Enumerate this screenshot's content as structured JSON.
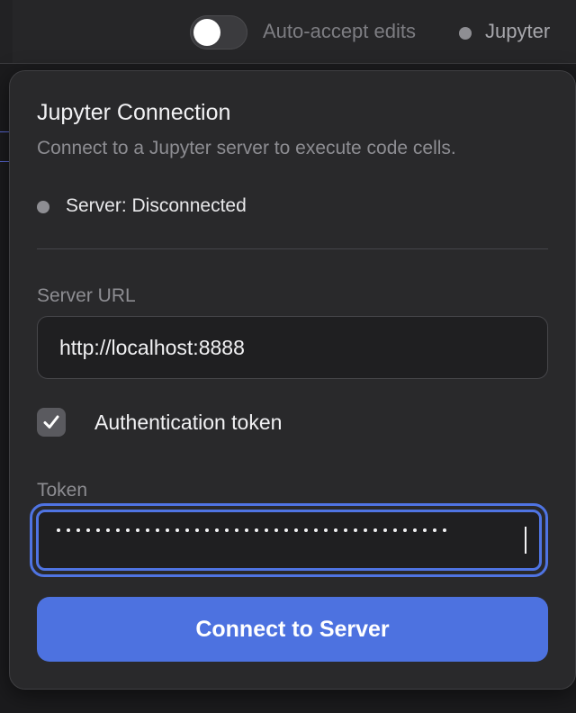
{
  "topbar": {
    "auto_accept_label": "Auto-accept edits",
    "auto_accept_on": false,
    "kernel_label": "Jupyter"
  },
  "panel": {
    "title": "Jupyter Connection",
    "subtitle": "Connect to a Jupyter server to execute code cells.",
    "status_text": "Server: Disconnected",
    "server_url_label": "Server URL",
    "server_url_value": "http://localhost:8888",
    "auth_checkbox_label": "Authentication token",
    "auth_checked": true,
    "token_label": "Token",
    "token_masked": "••••••••••••••••••••••••••••••••••••••••",
    "connect_label": "Connect to Server"
  },
  "colors": {
    "accent": "#4d72e0",
    "focus_ring": "#4f74e3",
    "panel_bg": "#29292b",
    "status_dot": "#8e8e93"
  },
  "icons": {
    "checkbox": "check-icon",
    "status": "status-dot-icon"
  }
}
